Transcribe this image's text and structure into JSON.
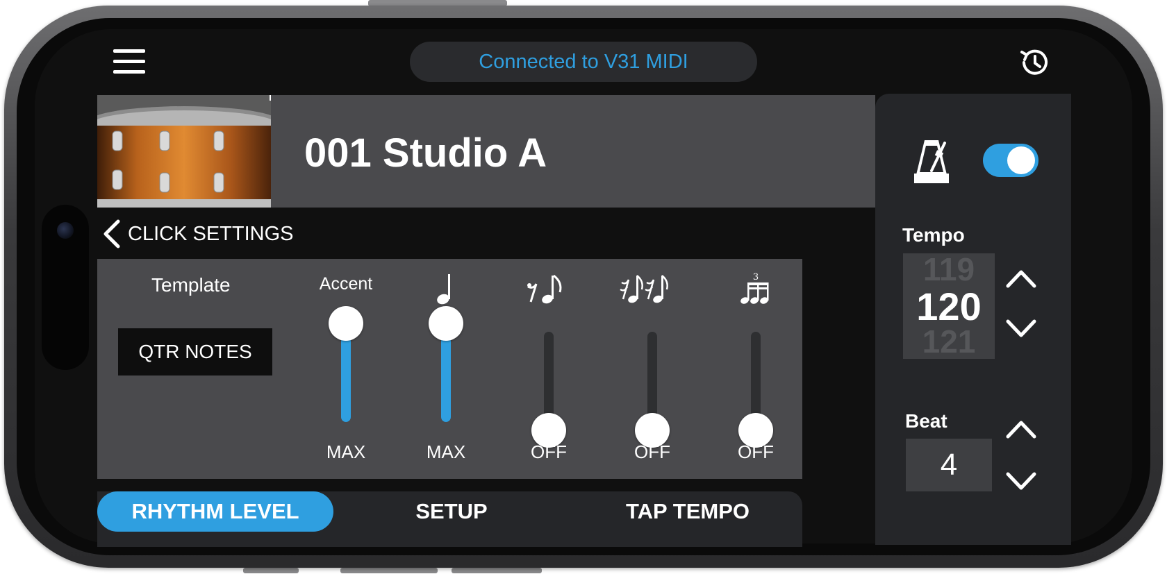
{
  "header": {
    "connection_status": "Connected to V31 MIDI"
  },
  "kit": {
    "title": "001 Studio A"
  },
  "click_settings": {
    "back_label": "CLICK SETTINGS",
    "template": {
      "label": "Template",
      "value": "QTR NOTES"
    },
    "faders": [
      {
        "name": "Accent",
        "header_text": "Accent",
        "icon": "accent",
        "value_label": "MAX",
        "level": 1.0
      },
      {
        "name": "quarter-note",
        "header_text": "♩",
        "icon": "quarter-note-icon",
        "value_label": "MAX",
        "level": 1.0
      },
      {
        "name": "eighth-note",
        "header_text": "𝄾♪",
        "icon": "eighth-note-icon",
        "value_label": "OFF",
        "level": 0.0
      },
      {
        "name": "sixteenth-note",
        "header_text": "𝄿♪𝄿♪",
        "icon": "sixteenth-note-icon",
        "value_label": "OFF",
        "level": 0.0
      },
      {
        "name": "triplet",
        "header_text": "♬",
        "icon": "triplet-icon",
        "value_label": "OFF",
        "level": 0.0
      }
    ]
  },
  "tabs": [
    {
      "label": "RHYTHM LEVEL",
      "active": true
    },
    {
      "label": "SETUP",
      "active": false
    },
    {
      "label": "TAP TEMPO",
      "active": false
    }
  ],
  "metronome": {
    "enabled": true,
    "tempo_label": "Tempo",
    "tempo_prev": "119",
    "tempo_current": "120",
    "tempo_next": "121",
    "beat_label": "Beat",
    "beat_value": "4"
  },
  "colors": {
    "accent": "#2f9fe0",
    "panel": "#4a4a4d",
    "background": "#101010"
  }
}
